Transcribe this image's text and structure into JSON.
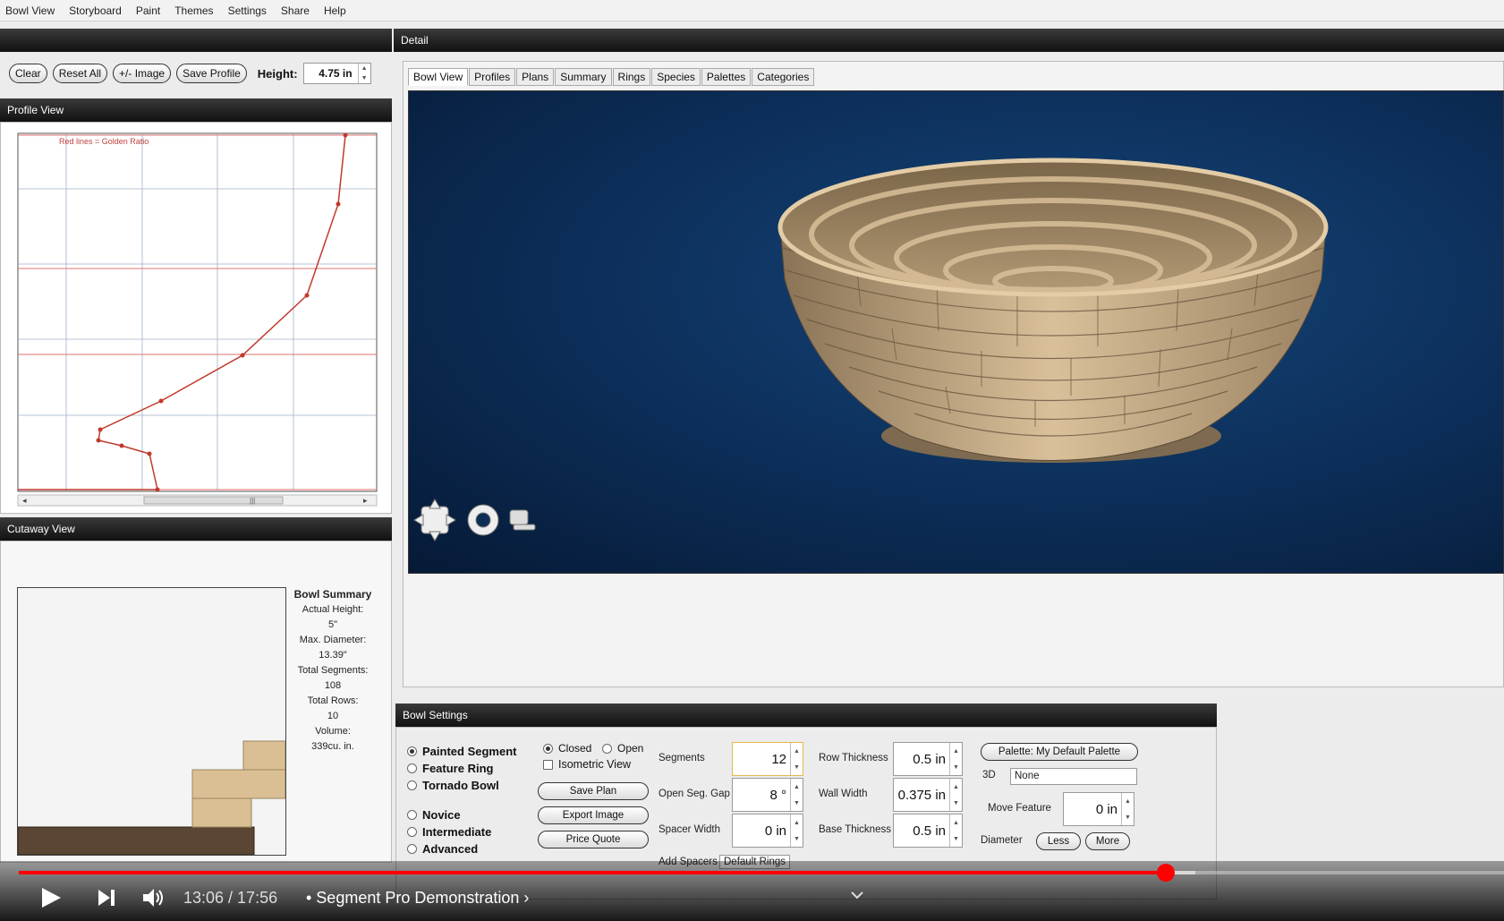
{
  "menu": [
    "Bowl View",
    "Storyboard",
    "Paint",
    "Themes",
    "Settings",
    "Share",
    "Help"
  ],
  "panels": {
    "detail": "Detail",
    "profile_view": "Profile View",
    "cutaway_view": "Cutaway View",
    "bowl_settings": "Bowl Settings"
  },
  "toolbar": {
    "clear": "Clear",
    "reset_all": "Reset All",
    "image": "+/- Image",
    "save_profile": "Save Profile",
    "height_label": "Height:",
    "height_value": "4.75 in"
  },
  "tabs": [
    "Bowl View",
    "Profiles",
    "Plans",
    "Summary",
    "Rings",
    "Species",
    "Palettes",
    "Categories"
  ],
  "profile": {
    "note": "Red lines = Golden Ratio",
    "scroll_thumb": "|||"
  },
  "summary": {
    "title": "Bowl Summary",
    "actual_height_label": "Actual Height:",
    "actual_height": "5\"",
    "max_diameter_label": "Max. Diameter:",
    "max_diameter": "13.39\"",
    "total_segments_label": "Total Segments:",
    "total_segments": "108",
    "total_rows_label": "Total Rows:",
    "total_rows": "10",
    "volume_label": "Volume:",
    "volume": "339cu. in."
  },
  "settings": {
    "type_options": [
      "Painted Segment",
      "Feature Ring",
      "Tornado Bowl"
    ],
    "level_options": [
      "Novice",
      "Intermediate",
      "Advanced"
    ],
    "closed": "Closed",
    "open": "Open",
    "isometric": "Isometric View",
    "save_plan": "Save Plan",
    "export_image": "Export Image",
    "price_quote": "Price Quote",
    "segments_label": "Segments",
    "segments": "12",
    "open_gap_label": "Open Seg. Gap",
    "open_gap": "8 °",
    "spacer_width_label": "Spacer Width",
    "spacer_width": "0 in",
    "add_spacers_label": "Add Spacers",
    "add_spacers": "Default Rings",
    "row_thickness_label": "Row Thickness",
    "row_thickness": "0.5 in",
    "wall_width_label": "Wall Width",
    "wall_width": "0.375 in",
    "base_thickness_label": "Base Thickness",
    "base_thickness": "0.5 in",
    "palette": "Palette: My Default Palette",
    "threed_label": "3D",
    "threed_value": "None",
    "move_feature_label": "Move Feature",
    "move_feature": "0 in",
    "diameter_label": "Diameter",
    "less": "Less",
    "more": "More"
  },
  "player": {
    "time": "13:06 / 17:56",
    "title": "• Segment Pro Demonstration ›",
    "progress": 0.772
  },
  "colors": {
    "accent_red": "#ff0000",
    "wood_light": "#d9bf93",
    "wood_dark": "#5a4632",
    "viewport_blue": "#0c2d57"
  }
}
